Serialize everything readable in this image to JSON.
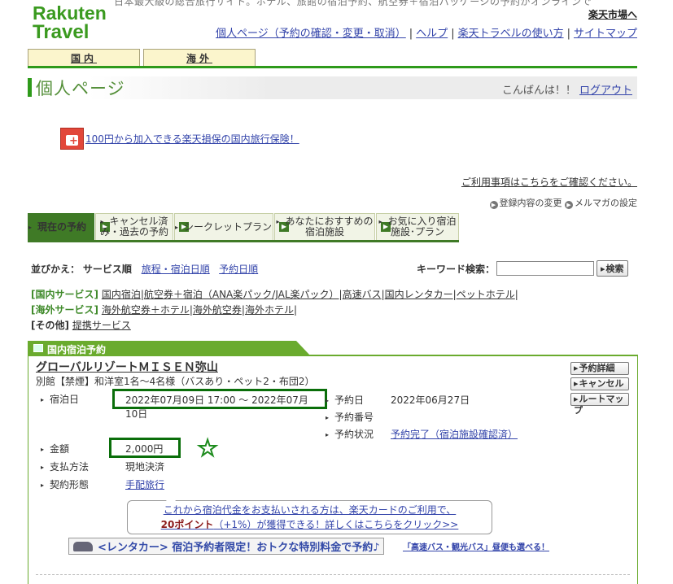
{
  "header": {
    "top_cut_text": "日本最大級の総合旅行サイト。ホテル、旅館の宿泊予約、航空券＋宿泊パッケージの予約がオンラインで",
    "logo_line1": "Rakuten",
    "logo_line2": "Travel",
    "ichiba_link": "楽天市場へ",
    "nav": [
      "個人ページ（予約の確認・変更・取消）",
      "ヘルプ",
      "楽天トラベルの使い方",
      "サイトマップ"
    ]
  },
  "area_tabs": [
    "国内",
    "海外"
  ],
  "page_title": "個人ページ",
  "greeting": "こんばんは！！",
  "logout": "ログアウト",
  "insurance_link": "100円から加入できる楽天損保の国内旅行保険！",
  "rules_link": "ご利用事項はこちらをご確認ください。",
  "settings": [
    "登録内容の変更",
    "メルマガの設定"
  ],
  "main_tabs": [
    {
      "label": "現在の予約",
      "active": true
    },
    {
      "label": "キャンセル済み・過去の予約"
    },
    {
      "label": "シークレットプラン"
    },
    {
      "label": "あなたにおすすめの宿泊施設"
    },
    {
      "label": "お気に入り宿泊施設･プラン"
    }
  ],
  "sort": {
    "label": "並びかえ：",
    "current": "サービス順",
    "options": [
      "旅程・宿泊日順",
      "予約日順"
    ]
  },
  "keyword": {
    "label": "キーワード検索：",
    "value": "",
    "button": "検索"
  },
  "services": {
    "domestic_label": "[国内サービス]",
    "domestic": [
      "国内宿泊",
      "航空券＋宿泊（ANA楽パック/JAL楽パック）",
      "高速バス",
      "国内レンタカー",
      "ペットホテル"
    ],
    "overseas_label": "[海外サービス]",
    "overseas": [
      "海外航空券＋ホテル",
      "海外航空券",
      "海外ホテル"
    ],
    "other_label": "[その他]",
    "other": [
      "提携サービス"
    ]
  },
  "section_title": "国内宿泊予約",
  "reservation": {
    "hotel": "グローバルリゾートＭＩＳＥＮ弥山",
    "room": "別館【禁煙】和洋室1名～4名様（バスあり・ペット2・布団2）",
    "buttons": [
      "予約詳細",
      "キャンセル",
      "ルートマップ"
    ],
    "stay_label": "宿泊日",
    "stay_value_line1": "2022年07月09日 17:00 ～ 2022年07月",
    "stay_value_line2": "10日",
    "booked_label": "予約日",
    "booked_value": "2022年06月27日",
    "number_label": "予約番号",
    "number_value": "",
    "status_label": "予約状況",
    "status_value": "予約完了（宿泊施設確認済）",
    "price_label": "金額",
    "price_value": "2,000円",
    "payment_label": "支払方法",
    "payment_value": "現地決済",
    "contract_label": "契約形態",
    "contract_value": "手配旅行"
  },
  "promo": {
    "line1": "これから宿泊代金をお支払いされる方は、楽天カードのご利用で、",
    "points": "20ポイント",
    "line2": "（+1%）が獲得できる！詳しくはこちらをクリック>>"
  },
  "rental_banner": "<レンタカー> 宿泊予約者限定！おトクな特別料金で予約♪",
  "bus_link": "「高速バス・観光バス」昼便も選べる！"
}
